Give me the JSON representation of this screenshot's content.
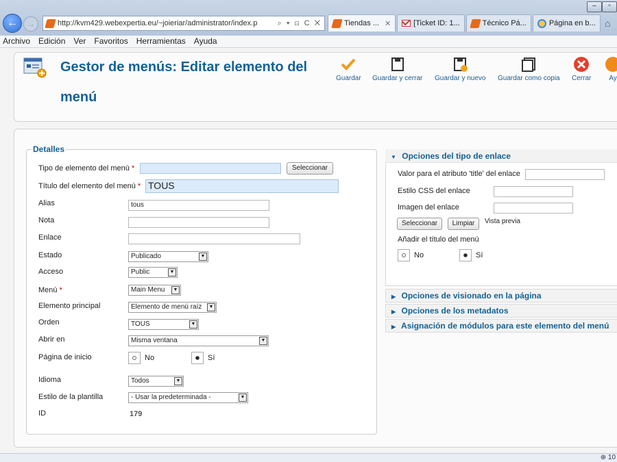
{
  "browser": {
    "url": "http://kvm429.webexpertia.eu/~joieriar/administrator/index.p",
    "addr_tools": "⌕ ▾ ⊡ C ✕",
    "tabs": [
      {
        "label": "Tiendas ...",
        "active": true
      },
      {
        "label": "[Ticket ID: 1...",
        "active": false
      },
      {
        "label": "Técnico Pá...",
        "active": false
      },
      {
        "label": "Página en b...",
        "active": false
      }
    ],
    "menu": [
      "Archivo",
      "Edición",
      "Ver",
      "Favoritos",
      "Herramientas",
      "Ayuda"
    ],
    "zoom": "⊕ 10"
  },
  "header": {
    "title": "Gestor de menús: Editar elemento del menú"
  },
  "toolbar": {
    "save": "Guardar",
    "save_close": "Guardar y cerrar",
    "save_new": "Guardar y nuevo",
    "save_copy": "Guardar como copia",
    "close": "Cerrar",
    "help": "Ay"
  },
  "details": {
    "legend": "Detalles",
    "tipo_label": "Tipo de elemento del menú",
    "tipo_value": "",
    "select_button": "Seleccionar",
    "titulo_label": "Título del elemento del menú",
    "titulo_value": "TOUS",
    "alias_label": "Alias",
    "alias_value": "tous",
    "nota_label": "Nota",
    "nota_value": "",
    "enlace_label": "Enlace",
    "enlace_value": "",
    "estado_label": "Estado",
    "estado_value": "Publicado",
    "acceso_label": "Acceso",
    "acceso_value": "Public",
    "menu_label": "Menú",
    "menu_value": "Main Menu",
    "principal_label": "Elemento principal",
    "principal_value": "Elemento de menú raíz",
    "orden_label": "Orden",
    "orden_value": "TOUS",
    "abrir_label": "Abrir en",
    "abrir_value": "Misma ventana",
    "inicio_label": "Página de inicio",
    "no_label": "No",
    "si_label": "Sí",
    "idioma_label": "Idioma",
    "idioma_value": "Todos",
    "estilo_label": "Estilo de la plantilla",
    "estilo_value": "- Usar la predeterminada -",
    "id_label": "ID",
    "id_value": "179",
    "required_mark": "*"
  },
  "link_options": {
    "title": "Opciones del tipo de enlace",
    "title_attr_label": "Valor para el atributo 'title' del enlace",
    "css_label": "Estilo CSS del enlace",
    "image_label": "Imagen del enlace",
    "select_button": "Seleccionar",
    "clear_button": "Limpiar",
    "preview_label": "Vista previa",
    "add_title_label": "Añadir el título del menú",
    "no_label": "No",
    "si_label": "Sí"
  },
  "accordion": {
    "display": "Opciones de visionado en la página",
    "metadata": "Opciones de los metadatos",
    "modules": "Asignación de módulos para este elemento del menú"
  }
}
